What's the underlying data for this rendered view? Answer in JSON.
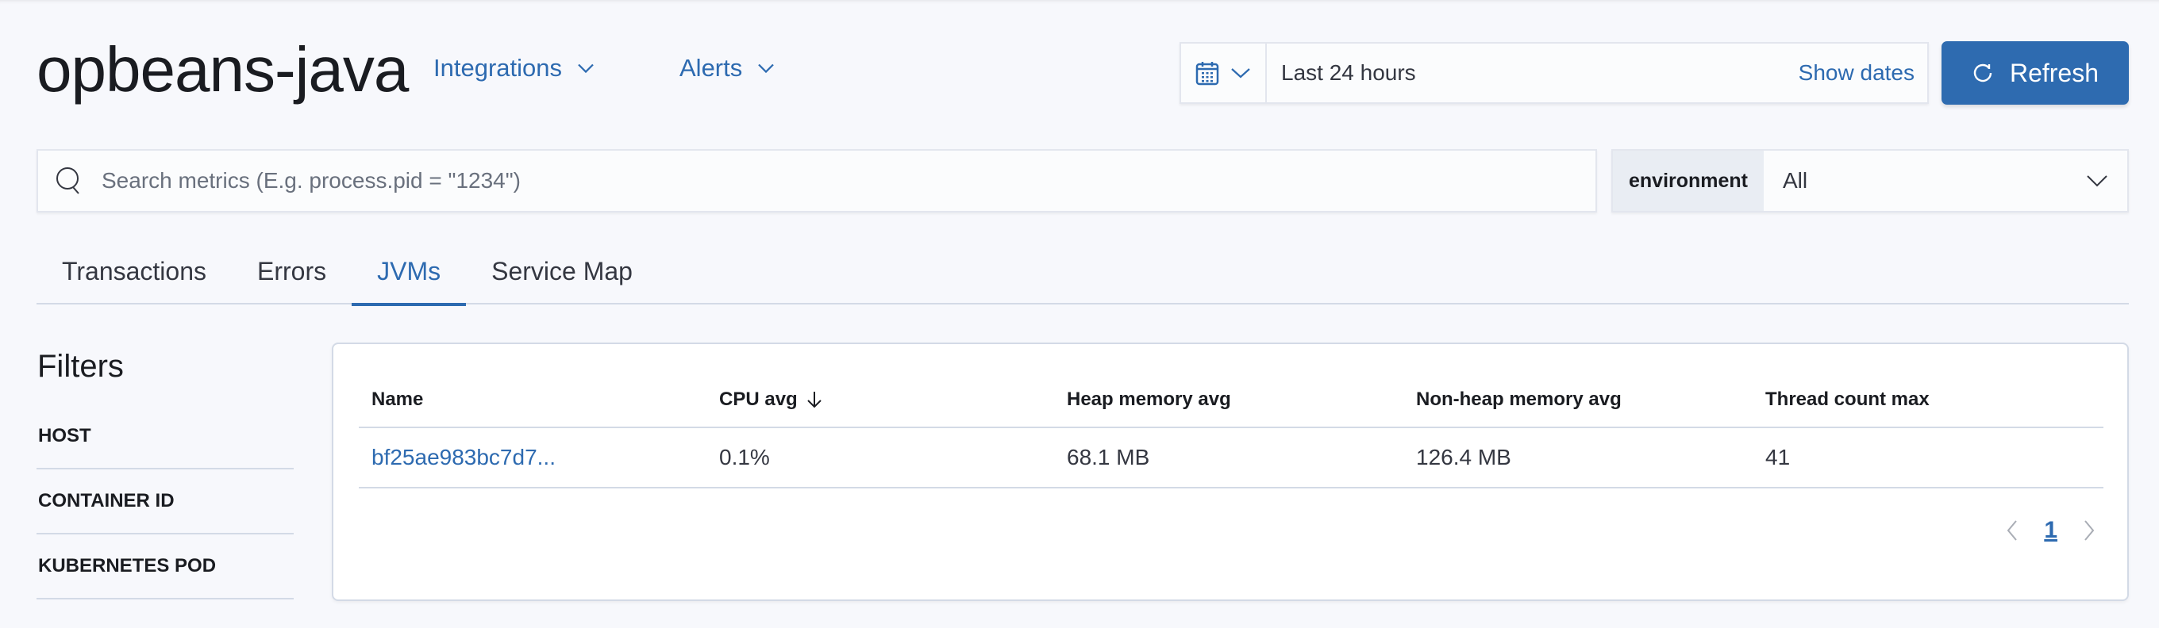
{
  "header": {
    "title": "opbeans-java",
    "nav": [
      {
        "label": "Integrations",
        "icon": "chevron-down-icon"
      },
      {
        "label": "Alerts",
        "icon": "chevron-down-icon"
      }
    ],
    "date_picker": {
      "icon": "calendar-icon",
      "value": "Last 24 hours",
      "show_dates_label": "Show dates"
    },
    "refresh": {
      "label": "Refresh",
      "icon": "refresh-icon"
    }
  },
  "search": {
    "placeholder": "Search metrics (E.g. process.pid = \"1234\")",
    "value": ""
  },
  "environment": {
    "label": "environment",
    "selected": "All"
  },
  "tabs": [
    {
      "label": "Transactions",
      "active": false
    },
    {
      "label": "Errors",
      "active": false
    },
    {
      "label": "JVMs",
      "active": true
    },
    {
      "label": "Service Map",
      "active": false
    }
  ],
  "filters": {
    "title": "Filters",
    "items": [
      "HOST",
      "CONTAINER ID",
      "KUBERNETES POD"
    ]
  },
  "table": {
    "columns": [
      {
        "label": "Name"
      },
      {
        "label": "CPU avg",
        "sort": "descending"
      },
      {
        "label": "Heap memory avg"
      },
      {
        "label": "Non-heap memory avg"
      },
      {
        "label": "Thread count max"
      }
    ],
    "rows": [
      {
        "name": "bf25ae983bc7d7...",
        "cpu_avg": "0.1%",
        "heap_memory_avg": "68.1 MB",
        "non_heap_memory_avg": "126.4 MB",
        "thread_count_max": "41"
      }
    ],
    "pagination": {
      "current_page": "1"
    }
  },
  "colors": {
    "accent": "#2d6ab0",
    "primary_button": "#2e6bb0",
    "background": "#f7f8fc",
    "border": "#d3dae6"
  }
}
